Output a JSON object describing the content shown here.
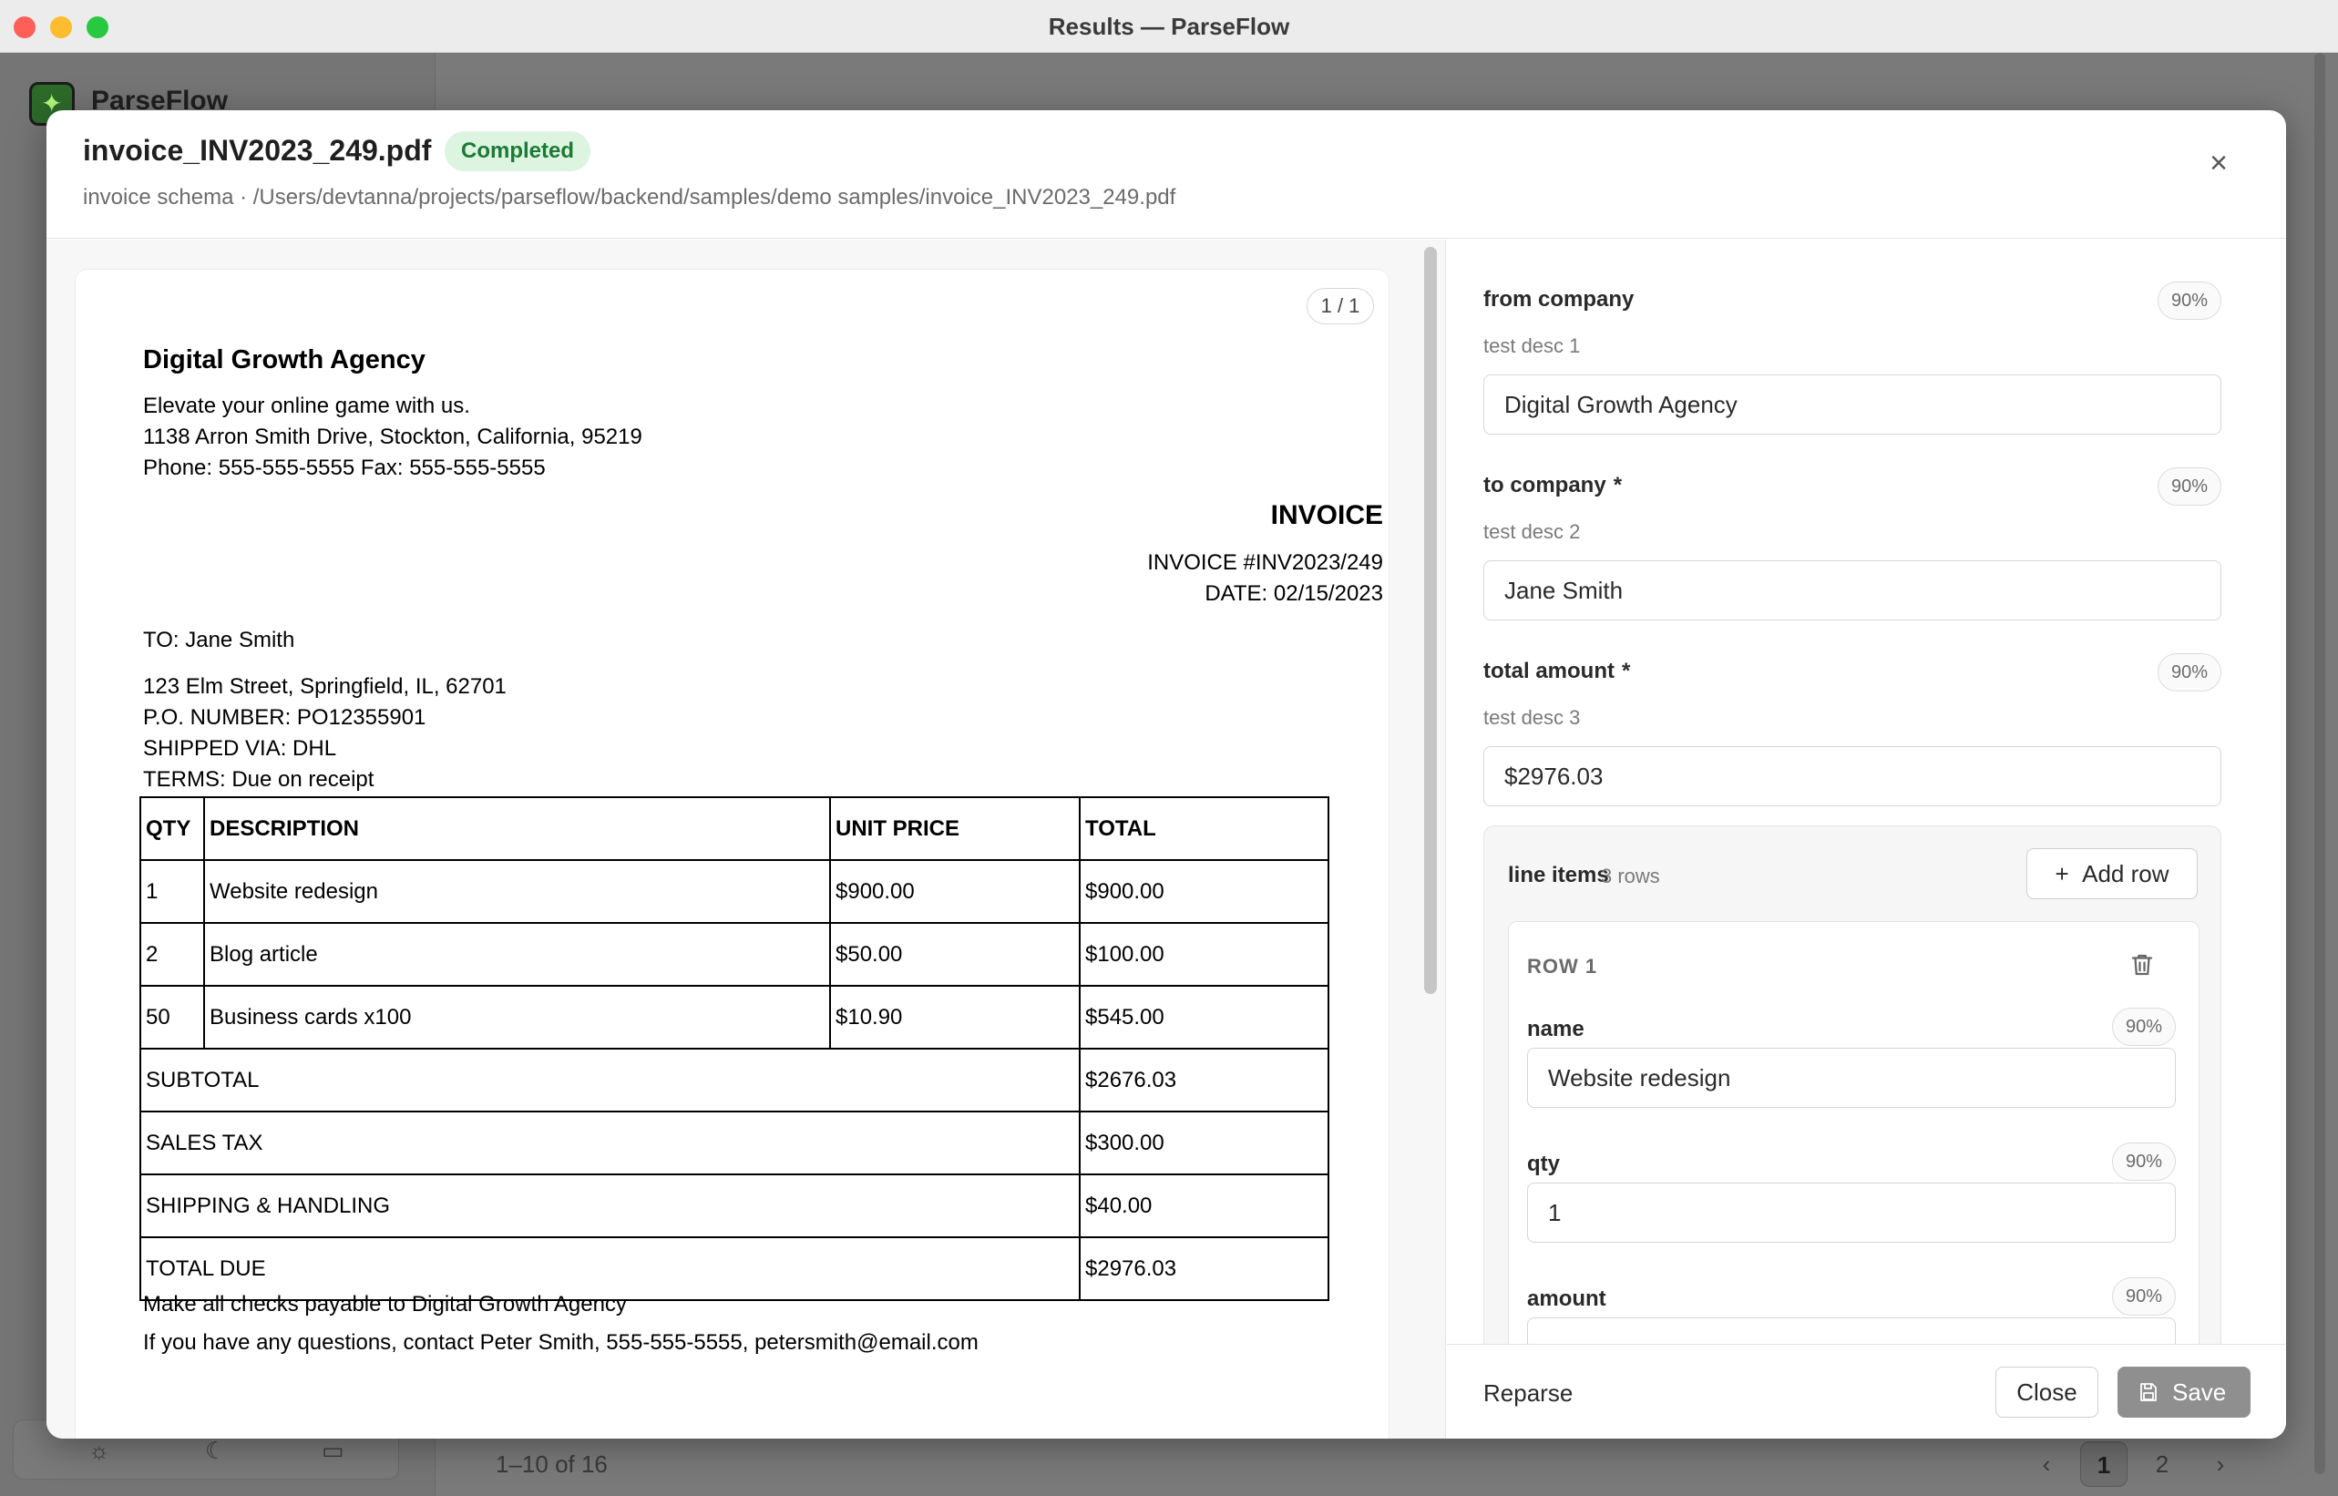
{
  "window": {
    "title": "Results — ParseFlow"
  },
  "app": {
    "brand": "ParseFlow",
    "pagination": {
      "info": "1–10 of 16",
      "pages": [
        "1",
        "2"
      ],
      "prev": "‹",
      "next": "›"
    }
  },
  "modal": {
    "filename": "invoice_INV2023_249.pdf",
    "status": "Completed",
    "path": "invoice schema · /Users/devtanna/projects/parseflow/backend/samples/demo samples/invoice_INV2023_249.pdf",
    "close_icon": "×"
  },
  "document": {
    "page_indicator": "1 / 1",
    "company": "Digital Growth Agency",
    "tagline": "Elevate your online game with us.",
    "address": "1138 Arron Smith Drive, Stockton, California, 95219",
    "phone": "Phone: 555-555-5555 Fax: 555-555-5555",
    "heading": "INVOICE",
    "invoice_no": "INVOICE #INV2023/249",
    "date": "DATE: 02/15/2023",
    "to": "TO: Jane Smith",
    "to_address": "123 Elm Street, Springfield, IL, 62701",
    "po": "P.O. NUMBER: PO12355901",
    "shipped": "SHIPPED VIA: DHL",
    "terms": "TERMS: Due on receipt",
    "table": {
      "headers": [
        "QTY",
        "DESCRIPTION",
        "UNIT PRICE",
        "TOTAL"
      ],
      "rows": [
        [
          "1",
          "Website redesign",
          "$900.00",
          "$900.00"
        ],
        [
          "2",
          "Blog article",
          "$50.00",
          "$100.00"
        ],
        [
          "50",
          "Business cards x100",
          "$10.90",
          "$545.00"
        ]
      ],
      "summary": [
        [
          "SUBTOTAL",
          "$2676.03"
        ],
        [
          "SALES TAX",
          "$300.00"
        ],
        [
          "SHIPPING & HANDLING",
          "$40.00"
        ],
        [
          "TOTAL DUE",
          "$2976.03"
        ]
      ]
    },
    "checks_note": "Make all checks payable to Digital Growth Agency",
    "contact_note": "If you have any questions, contact Peter Smith, 555-555-5555, petersmith@email.com"
  },
  "fields": {
    "from_company": {
      "label": "from company",
      "confidence": "90%",
      "desc": "test desc 1",
      "value": "Digital Growth Agency"
    },
    "to_company": {
      "label": "to company",
      "required": "*",
      "confidence": "90%",
      "desc": "test desc 2",
      "value": "Jane Smith"
    },
    "total_amount": {
      "label": "total amount",
      "required": "*",
      "confidence": "90%",
      "desc": "test desc 3",
      "value": "$2976.03"
    }
  },
  "line_items": {
    "label": "line items",
    "count": "3 rows",
    "add_row": "Add row",
    "row1": {
      "title": "ROW 1",
      "name": {
        "label": "name",
        "confidence": "90%",
        "value": "Website redesign"
      },
      "qty": {
        "label": "qty",
        "confidence": "90%",
        "value": "1"
      },
      "amount": {
        "label": "amount",
        "confidence": "90%"
      }
    }
  },
  "footer": {
    "reparse": "Reparse",
    "close": "Close",
    "save": "Save"
  },
  "colors": {
    "status_bg": "#dcf4e0",
    "status_fg": "#1d7a35",
    "save_btn": "#8f8f8f"
  }
}
